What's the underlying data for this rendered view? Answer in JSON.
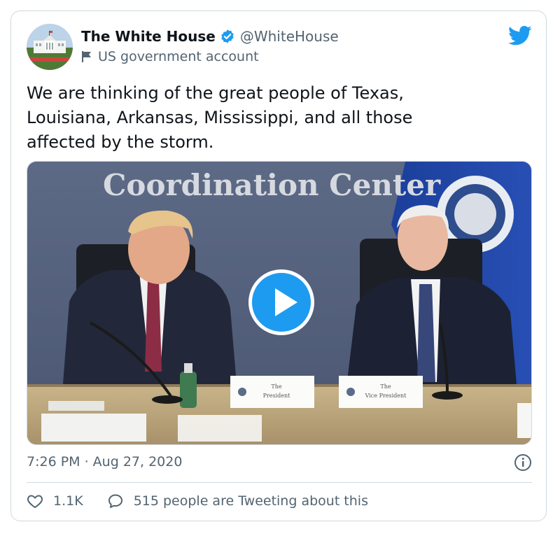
{
  "account": {
    "display_name": "The White House",
    "handle": "@WhiteHouse",
    "label": "US government account"
  },
  "tweet": {
    "text": "We are thinking of the great people of Texas,\nLouisiana, Arkansas, Mississippi, and all those\naffected by the storm.",
    "timestamp": "7:26 PM · Aug 27, 2020"
  },
  "video_frame": {
    "wall_sign": "Coordination Center",
    "placard_left": [
      "The",
      "President"
    ],
    "placard_right": [
      "The",
      "Vice President"
    ]
  },
  "engagement": {
    "likes": "1.1K",
    "tweeting": "515 people are Tweeting about this"
  },
  "colors": {
    "accent": "#1d9bf0",
    "text_primary": "#0f1419",
    "text_secondary": "#536471",
    "border": "#cfd9de"
  },
  "icons": {
    "verified": "verified-badge-icon",
    "label": "flag-icon",
    "brand": "twitter-bird-icon",
    "play": "play-icon",
    "info": "info-icon",
    "like": "heart-icon",
    "reply": "speech-bubble-icon"
  }
}
